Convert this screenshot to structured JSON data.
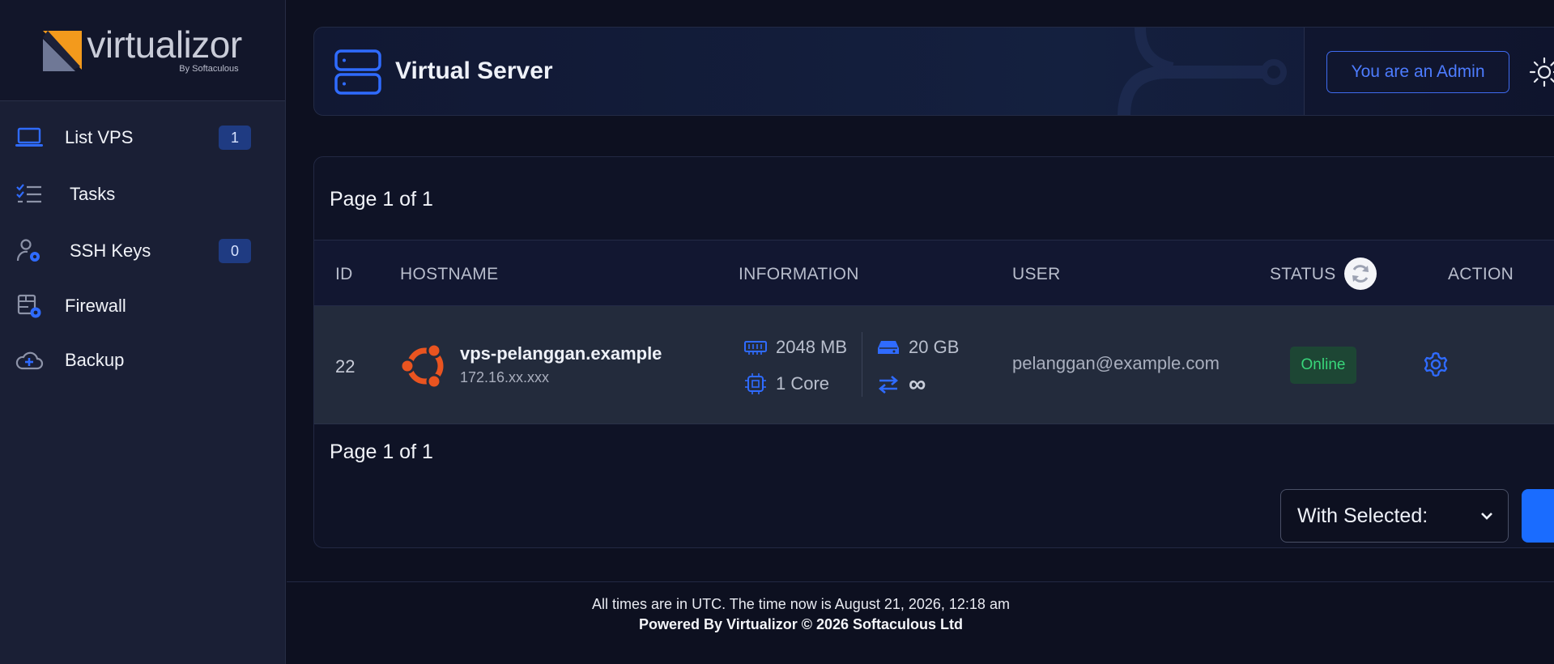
{
  "logo": {
    "name": "virtualizor",
    "by": "By Softaculous"
  },
  "sidebar": {
    "items": [
      {
        "label": "List VPS",
        "icon": "laptop-icon",
        "badge": "1"
      },
      {
        "label": "Tasks",
        "icon": "checklist-icon"
      },
      {
        "label": "SSH Keys",
        "icon": "user-key-icon",
        "badge": "0"
      },
      {
        "label": "Firewall",
        "icon": "firewall-icon"
      },
      {
        "label": "Backup",
        "icon": "cloud-backup-icon"
      }
    ]
  },
  "header": {
    "title": "Virtual Server",
    "admin_label": "You are an Admin",
    "theme_icon": "sun-icon"
  },
  "table": {
    "page_top": "Page 1 of 1",
    "page_bottom": "Page 1 of 1",
    "columns": [
      "ID",
      "HOSTNAME",
      "INFORMATION",
      "USER",
      "STATUS",
      "ACTION"
    ],
    "rows": [
      {
        "id": "22",
        "os_icon": "ubuntu-icon",
        "hostname": "vps-pelanggan.example",
        "ip": "172.16.xx.xxx",
        "ram": "2048 MB",
        "cpu": "1 Core",
        "disk": "20 GB",
        "bandwidth": "∞",
        "user": "pelanggan@example.com",
        "status": "Online"
      }
    ],
    "bulk_select": "With Selected:"
  },
  "footer": {
    "time_note": "All times are in UTC. The time now is August 21, 2026, 12:18 am",
    "powered": "Powered By Virtualizor © 2026 Softaculous Ltd"
  },
  "colors": {
    "accent": "#1a6cff",
    "online_text": "#38d67a",
    "online_bg": "#1d4634",
    "ubuntu": "#e95420"
  }
}
